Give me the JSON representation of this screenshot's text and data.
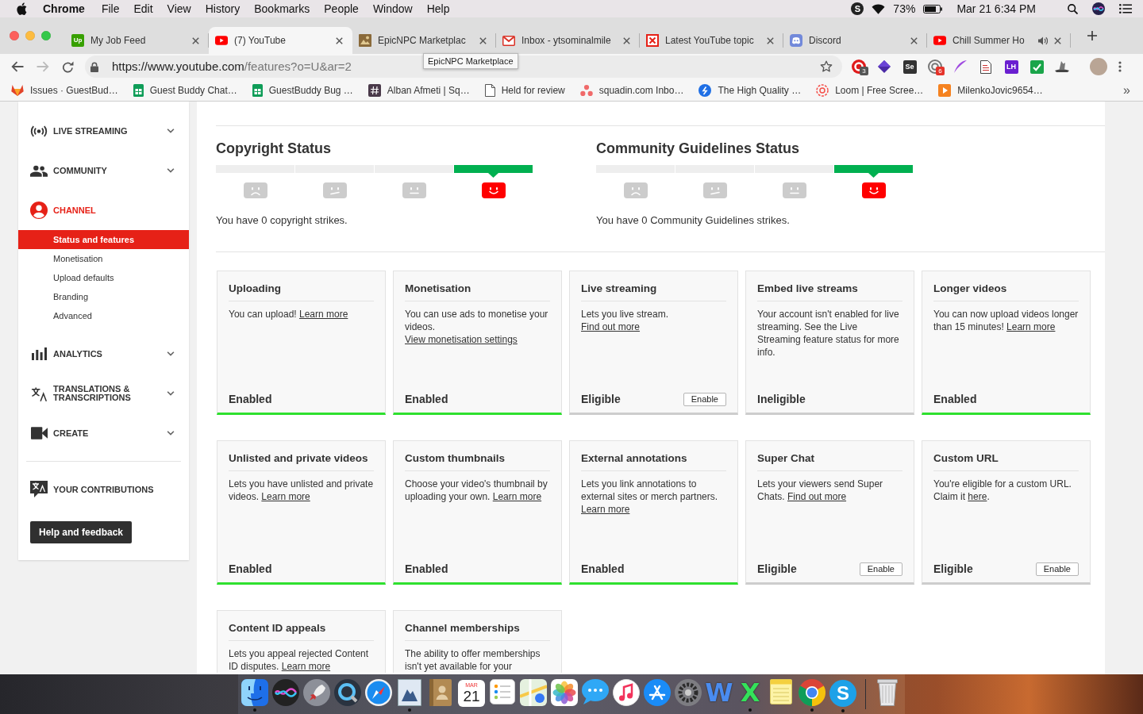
{
  "menubar": {
    "app": "Chrome",
    "menus": [
      "File",
      "Edit",
      "View",
      "History",
      "Bookmarks",
      "People",
      "Window",
      "Help"
    ],
    "tray_label": "S",
    "battery": "73%",
    "clock": "Mar 21 6:34 PM"
  },
  "tabs": [
    {
      "title": "My Job Feed",
      "kind": "tile",
      "favicon_label": "Up",
      "selected": false,
      "audio": false
    },
    {
      "title": "(7) YouTube",
      "kind": "play",
      "selected": true,
      "audio": false
    },
    {
      "title": "EpicNPC Marketplac",
      "kind": "image",
      "selected": false,
      "audio": false
    },
    {
      "title": "Inbox - ytsominalmile",
      "kind": "mail",
      "selected": false,
      "audio": false
    },
    {
      "title": "Latest YouTube topic",
      "kind": "crossed",
      "selected": false,
      "audio": false
    },
    {
      "title": "Discord",
      "kind": "chat",
      "selected": false,
      "audio": false
    },
    {
      "title": "Chill Summer Ho",
      "kind": "play",
      "selected": false,
      "audio": true
    }
  ],
  "tooltip": "EpicNPC Marketplace",
  "toolbar": {
    "url_host": "https://www.youtube.com",
    "url_path": "/features?o=U&ar=2",
    "extensions": [
      {
        "kind": "ring",
        "badge": "3"
      },
      {
        "kind": "diamond"
      },
      {
        "kind": "tile",
        "label": "Se",
        "color": "#333333"
      },
      {
        "kind": "swirl",
        "badge": "6"
      },
      {
        "kind": "feather"
      },
      {
        "kind": "document"
      },
      {
        "kind": "tile",
        "label": "LH",
        "color": "#6a1fd0"
      },
      {
        "kind": "check"
      },
      {
        "kind": "hat"
      }
    ]
  },
  "bookmarks": {
    "items": [
      {
        "kind": "fox",
        "label": "Issues · GuestBud…"
      },
      {
        "kind": "sheet",
        "label": "Guest Buddy Chat…"
      },
      {
        "kind": "sheet",
        "label": "GuestBuddy Bug …"
      },
      {
        "kind": "hash",
        "label": "Alban Afmeti | Sq…"
      },
      {
        "kind": "page",
        "label": "Held for review"
      },
      {
        "kind": "dots",
        "label": "squadin.com Inbo…"
      },
      {
        "kind": "bolt",
        "label": "The High Quality …"
      },
      {
        "kind": "burst",
        "label": "Loom | Free Scree…"
      },
      {
        "kind": "playtile",
        "label": "MilenkoJovic9654…"
      }
    ],
    "more": "»"
  },
  "sidebar": {
    "sections": [
      {
        "kind": "live",
        "label": "LIVE STREAMING",
        "selected": false,
        "expanded": false
      },
      {
        "kind": "community",
        "label": "COMMUNITY",
        "selected": false,
        "expanded": false
      },
      {
        "kind": "channel",
        "label": "CHANNEL",
        "selected": true,
        "expanded": true,
        "children": [
          {
            "label": "Status and features",
            "selected": true
          },
          {
            "label": "Monetisation",
            "selected": false
          },
          {
            "label": "Upload defaults",
            "selected": false
          },
          {
            "label": "Branding",
            "selected": false
          },
          {
            "label": "Advanced",
            "selected": false
          }
        ]
      },
      {
        "kind": "analytics",
        "label": "ANALYTICS",
        "selected": false,
        "expanded": false
      },
      {
        "kind": "translations",
        "label": "TRANSLATIONS & TRANSCRIPTIONS",
        "selected": false,
        "expanded": false
      },
      {
        "kind": "create",
        "label": "CREATE",
        "selected": false,
        "expanded": false
      }
    ],
    "contributions": "YOUR CONTRIBUTIONS",
    "help_button": "Help and feedback"
  },
  "status": [
    {
      "title": "Copyright Status",
      "levels": [
        {
          "kind": "sad",
          "selected": false
        },
        {
          "kind": "uneasy",
          "selected": false
        },
        {
          "kind": "neutral",
          "selected": false
        },
        {
          "kind": "happy",
          "selected": true
        }
      ],
      "message": "You have 0 copyright strikes."
    },
    {
      "title": "Community Guidelines Status",
      "levels": [
        {
          "kind": "sad",
          "selected": false
        },
        {
          "kind": "uneasy",
          "selected": false
        },
        {
          "kind": "neutral",
          "selected": false
        },
        {
          "kind": "happy",
          "selected": true
        }
      ],
      "message": "You have 0 Community Guidelines strikes."
    }
  ],
  "features": [
    {
      "title": "Uploading",
      "description": [
        {
          "kind": "text",
          "text": "You can upload! "
        },
        {
          "kind": "link",
          "text": "Learn more"
        }
      ],
      "status": "Enabled",
      "on": true
    },
    {
      "title": "Monetisation",
      "description": [
        {
          "kind": "text",
          "text": "You can use ads to monetise your videos. "
        },
        {
          "kind": "link",
          "text": "View monetisation settings"
        }
      ],
      "status": "Enabled",
      "on": true
    },
    {
      "title": "Live streaming",
      "description": [
        {
          "kind": "text",
          "text": "Lets you live stream. "
        },
        {
          "kind": "link",
          "text": "Find out more"
        }
      ],
      "status": "Eligible",
      "on": false,
      "button": "Enable"
    },
    {
      "title": "Embed live streams",
      "description": [
        {
          "kind": "text",
          "text": "Your account isn't enabled for live streaming. See the Live Streaming feature status for more info."
        }
      ],
      "status": "Ineligible",
      "on": false
    },
    {
      "title": "Longer videos",
      "description": [
        {
          "kind": "text",
          "text": "You can now upload videos longer than 15 minutes! "
        },
        {
          "kind": "link",
          "text": "Learn more"
        }
      ],
      "status": "Enabled",
      "on": true
    },
    {
      "title": "Unlisted and private videos",
      "description": [
        {
          "kind": "text",
          "text": "Lets you have unlisted and private videos. "
        },
        {
          "kind": "link",
          "text": "Learn more"
        }
      ],
      "status": "Enabled",
      "on": true
    },
    {
      "title": "Custom thumbnails",
      "description": [
        {
          "kind": "text",
          "text": "Choose your video's thumbnail by uploading your own. "
        },
        {
          "kind": "link",
          "text": "Learn more"
        }
      ],
      "status": "Enabled",
      "on": true
    },
    {
      "title": "External annotations",
      "description": [
        {
          "kind": "text",
          "text": "Lets you link annotations to external sites or merch partners. "
        },
        {
          "kind": "link",
          "text": "Learn more"
        }
      ],
      "status": "Enabled",
      "on": true
    },
    {
      "title": "Super Chat",
      "description": [
        {
          "kind": "text",
          "text": "Lets your viewers send Super Chats. "
        },
        {
          "kind": "link",
          "text": "Find out more"
        }
      ],
      "status": "Eligible",
      "on": false,
      "button": "Enable"
    },
    {
      "title": "Custom URL",
      "description": [
        {
          "kind": "text",
          "text": "You're eligible for a custom URL. Claim it "
        },
        {
          "kind": "link",
          "text": "here"
        },
        {
          "kind": "text",
          "text": "."
        }
      ],
      "status": "Eligible",
      "on": false,
      "button": "Enable"
    },
    {
      "title": "Content ID appeals",
      "description": [
        {
          "kind": "text",
          "text": "Lets you appeal rejected Content ID disputes. "
        },
        {
          "kind": "link",
          "text": "Learn more"
        }
      ]
    },
    {
      "title": "Channel memberships",
      "description": [
        {
          "kind": "text",
          "text": "The ability to offer memberships isn't yet available for your"
        }
      ]
    }
  ],
  "dock": [
    {
      "kind": "face",
      "running": true
    },
    {
      "kind": "orb",
      "running": false
    },
    {
      "kind": "rocket",
      "running": false
    },
    {
      "kind": "lens",
      "running": false
    },
    {
      "kind": "compass",
      "running": false
    },
    {
      "kind": "stamp",
      "running": true
    },
    {
      "kind": "book",
      "running": false
    },
    {
      "kind": "calendar",
      "month": "MAR",
      "day": "21",
      "running": false
    },
    {
      "kind": "checklist",
      "running": false
    },
    {
      "kind": "map",
      "running": false
    },
    {
      "kind": "flower",
      "running": false
    },
    {
      "kind": "bubble",
      "running": false
    },
    {
      "kind": "note",
      "running": false
    },
    {
      "kind": "sticks",
      "running": false
    },
    {
      "kind": "gear",
      "running": false
    },
    {
      "kind": "letter",
      "label": "W",
      "color": "#4a8cf0",
      "running": false
    },
    {
      "kind": "letter",
      "label": "X",
      "color": "#34e25a",
      "running": true
    },
    {
      "kind": "notepad",
      "running": false
    },
    {
      "kind": "wheel",
      "running": true
    },
    {
      "kind": "disc",
      "label": "S",
      "color": "#1da1e8",
      "running": true
    }
  ]
}
